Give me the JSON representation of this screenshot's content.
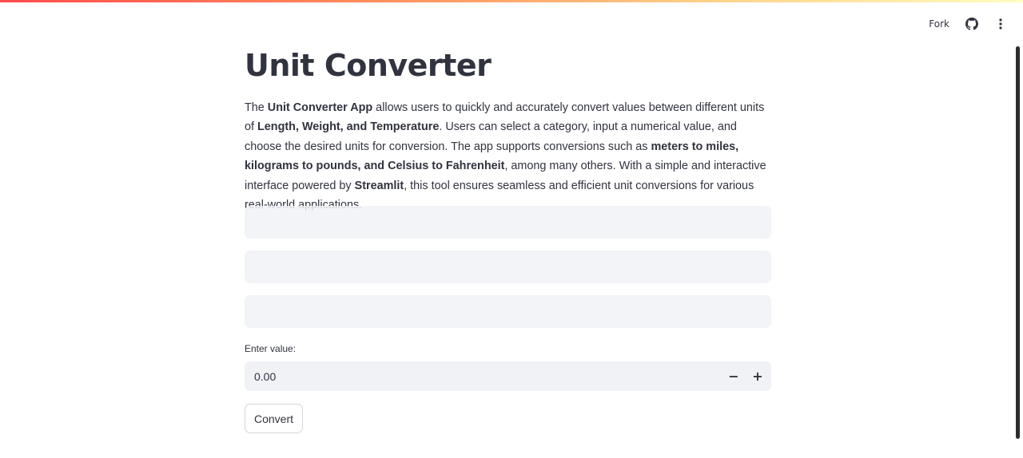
{
  "header": {
    "fork_label": "Fork",
    "github_icon": "github-icon",
    "menu_icon": "vertical-ellipsis-icon"
  },
  "page": {
    "title": "Unit Converter",
    "description": {
      "s1": "The ",
      "b1": "Unit Converter App",
      "s2": " allows users to quickly and accurately convert values between different units of ",
      "b2": "Length, Weight, and Temperature",
      "s3": ". Users can select a category, input a numerical value, and choose the desired units for conversion. The app supports conversions such as ",
      "b3": "meters to miles, kilograms to pounds, and Celsius to Fahrenheit",
      "s4": ", among many others. With a simple and interactive interface powered by ",
      "b4": "Streamlit",
      "s5": ", this tool ensures seamless and efficient unit conversions for various real-world applications."
    }
  },
  "form": {
    "value_label": "Enter value:",
    "value": "0.00",
    "minus_label": "−",
    "plus_label": "+",
    "convert_label": "Convert"
  },
  "colors": {
    "accent_gradient_start": "#ff4b4b",
    "accent_gradient_end": "#fffdc0",
    "text": "#31333f",
    "input_bg": "#f0f2f6"
  }
}
